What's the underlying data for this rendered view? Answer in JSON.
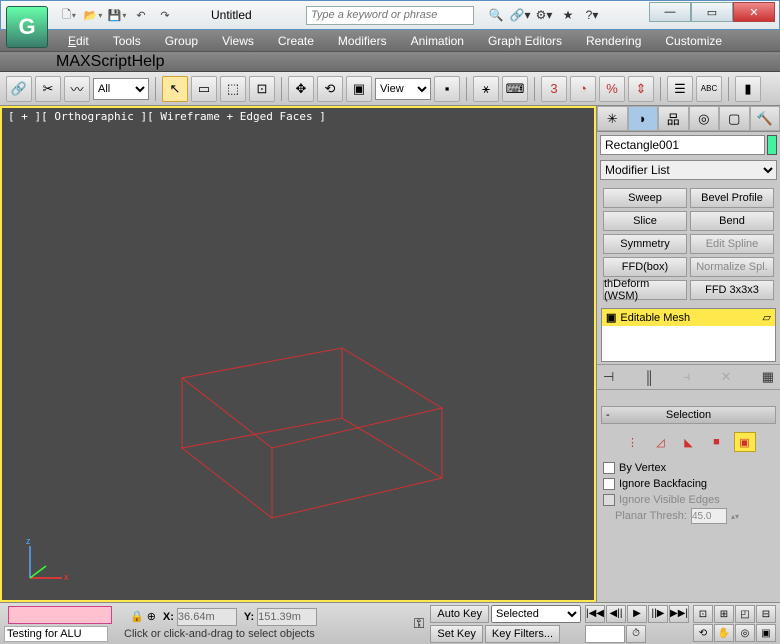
{
  "title": "Untitled",
  "search_placeholder": "Type a keyword or phrase",
  "menus": {
    "edit": "Edit",
    "tools": "Tools",
    "group": "Group",
    "views": "Views",
    "create": "Create",
    "modifiers": "Modifiers",
    "animation": "Animation",
    "graph": "Graph Editors",
    "rendering": "Rendering",
    "customize": "Customize",
    "maxscript": "MAXScript",
    "help": "Help"
  },
  "toolbar": {
    "selection_filter": "All",
    "ref_coord": "View"
  },
  "viewport": {
    "label": "[ + ][ Orthographic ][ Wireframe + Edged Faces ]"
  },
  "cmd": {
    "object_name": "Rectangle001",
    "modifier_list": "Modifier List",
    "buttons": {
      "sweep": "Sweep",
      "bevel_profile": "Bevel Profile",
      "slice": "Slice",
      "bend": "Bend",
      "symmetry": "Symmetry",
      "edit_spline": "Edit Spline",
      "ffdbox": "FFD(box)",
      "normalize": "Normalize Spl.",
      "thdeform": "thDeform (WSM)",
      "ffd3": "FFD 3x3x3"
    },
    "stack_item": "Editable Mesh",
    "rollout_selection": "Selection",
    "chk_by_vertex": "By Vertex",
    "chk_ignore_backfacing": "Ignore Backfacing",
    "chk_ignore_visible": "Ignore Visible Edges",
    "planar_label": "Planar Thresh:",
    "planar_value": "45.0"
  },
  "status": {
    "testing": "Testing for ALU",
    "x_label": "X:",
    "x_value": "36.64m",
    "y_label": "Y:",
    "y_value": "151.39m",
    "hint": "Click or click-and-drag to select objects",
    "autokey": "Auto Key",
    "setkey": "Set Key",
    "mode": "Selected",
    "keyfilters": "Key Filters..."
  }
}
